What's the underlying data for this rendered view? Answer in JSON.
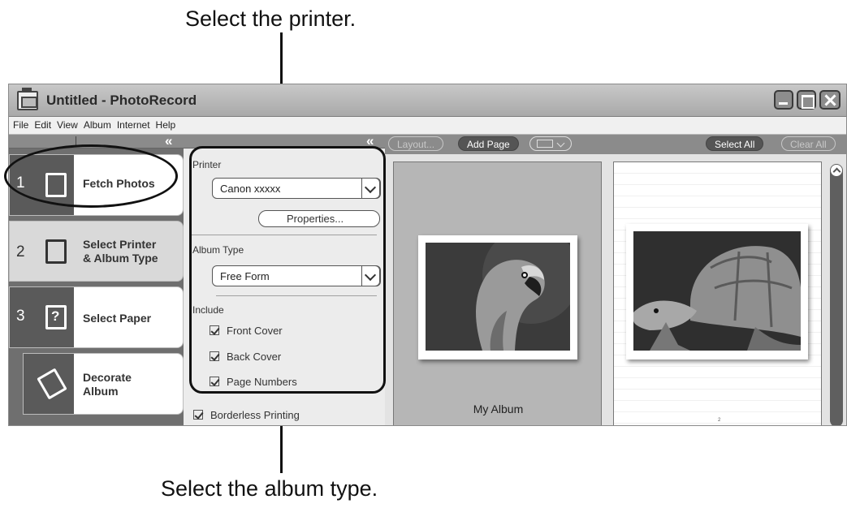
{
  "callouts": {
    "top": "Select the printer.",
    "bottom": "Select the album type."
  },
  "window": {
    "title": "Untitled - PhotoRecord",
    "menu": [
      "File",
      "Edit",
      "View",
      "Album",
      "Internet",
      "Help"
    ]
  },
  "steps": [
    {
      "number": "1",
      "label": "Fetch Photos",
      "icon": "fetch-photos-icon"
    },
    {
      "number": "2",
      "label": "Select Printer\n& Album Type",
      "icon": "printer-pages-icon"
    },
    {
      "number": "3",
      "label": "Select Paper",
      "icon": "paper-question-icon"
    },
    {
      "number": "",
      "label": "Decorate\nAlbum",
      "icon": "decorate-wand-icon"
    }
  ],
  "settings": {
    "printer_label": "Printer",
    "printer_value": "Canon xxxxx",
    "properties_button": "Properties...",
    "album_type_label": "Album Type",
    "album_type_value": "Free Form",
    "include_label": "Include",
    "include_items": [
      {
        "label": "Front Cover",
        "checked": true
      },
      {
        "label": "Back Cover",
        "checked": true
      },
      {
        "label": "Page Numbers",
        "checked": true
      }
    ],
    "borderless": {
      "label": "Borderless Printing",
      "checked": true
    }
  },
  "toolbar": {
    "layout": "Layout...",
    "add_page": "Add Page",
    "select_all": "Select All",
    "clear_all": "Clear All"
  },
  "preview": {
    "album_title": "My Album",
    "page_number": "2"
  },
  "colors": {
    "active_step": "#d9d9d9",
    "sidebar": "#6f6f6f",
    "toolbar": "#8b8b8b"
  }
}
